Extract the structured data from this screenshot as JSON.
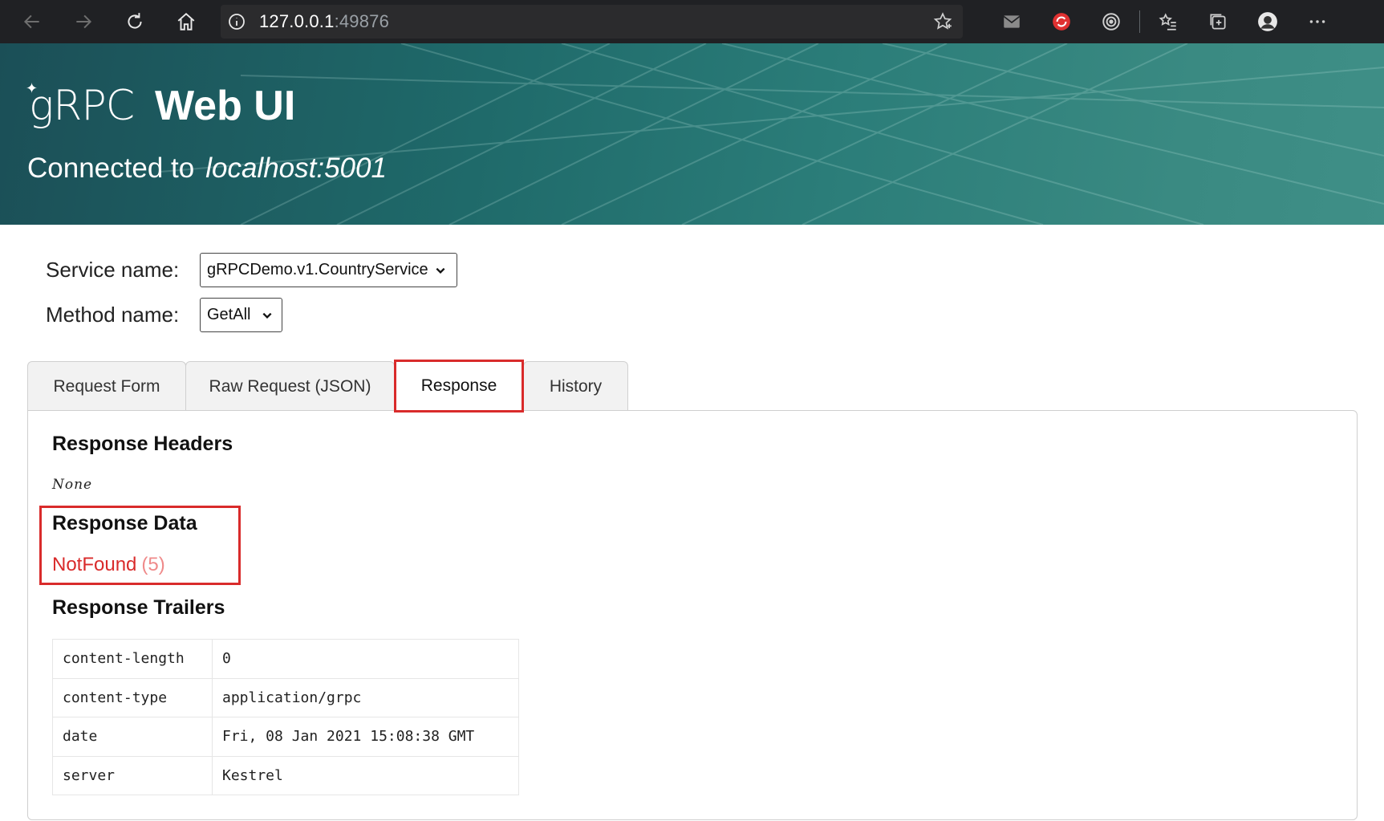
{
  "browser": {
    "url_host": "127.0.0.1",
    "url_port": ":49876",
    "icons": [
      "back-arrow-icon",
      "forward-arrow-icon",
      "refresh-icon",
      "home-icon",
      "info-icon",
      "favorite-star-icon",
      "mail-icon",
      "extension-red-icon",
      "target-icon",
      "favorites-list-icon",
      "collections-icon",
      "profile-avatar-icon",
      "more-menu-icon"
    ]
  },
  "banner": {
    "logo": "gRPC",
    "title": "Web UI",
    "connected_label": "Connected to",
    "host": "localhost:5001"
  },
  "form": {
    "service_label": "Service name:",
    "service_value": "gRPCDemo.v1.CountryService",
    "method_label": "Method name:",
    "method_value": "GetAll"
  },
  "tabs": [
    {
      "label": "Request Form"
    },
    {
      "label": "Raw Request (JSON)"
    },
    {
      "label": "Response"
    },
    {
      "label": "History"
    }
  ],
  "response": {
    "headers_title": "Response Headers",
    "headers_value": "None",
    "data_title": "Response Data",
    "status_name": "NotFound",
    "status_code": "(5)",
    "trailers_title": "Response Trailers",
    "trailers": [
      {
        "key": "content-length",
        "value": "0"
      },
      {
        "key": "content-type",
        "value": "application/grpc"
      },
      {
        "key": "date",
        "value": "Fri, 08 Jan 2021 15:08:38 GMT"
      },
      {
        "key": "server",
        "value": "Kestrel"
      }
    ]
  },
  "colors": {
    "highlight": "#d92b2b",
    "banner": "#1f6a6a",
    "browser_bar": "#202124"
  }
}
